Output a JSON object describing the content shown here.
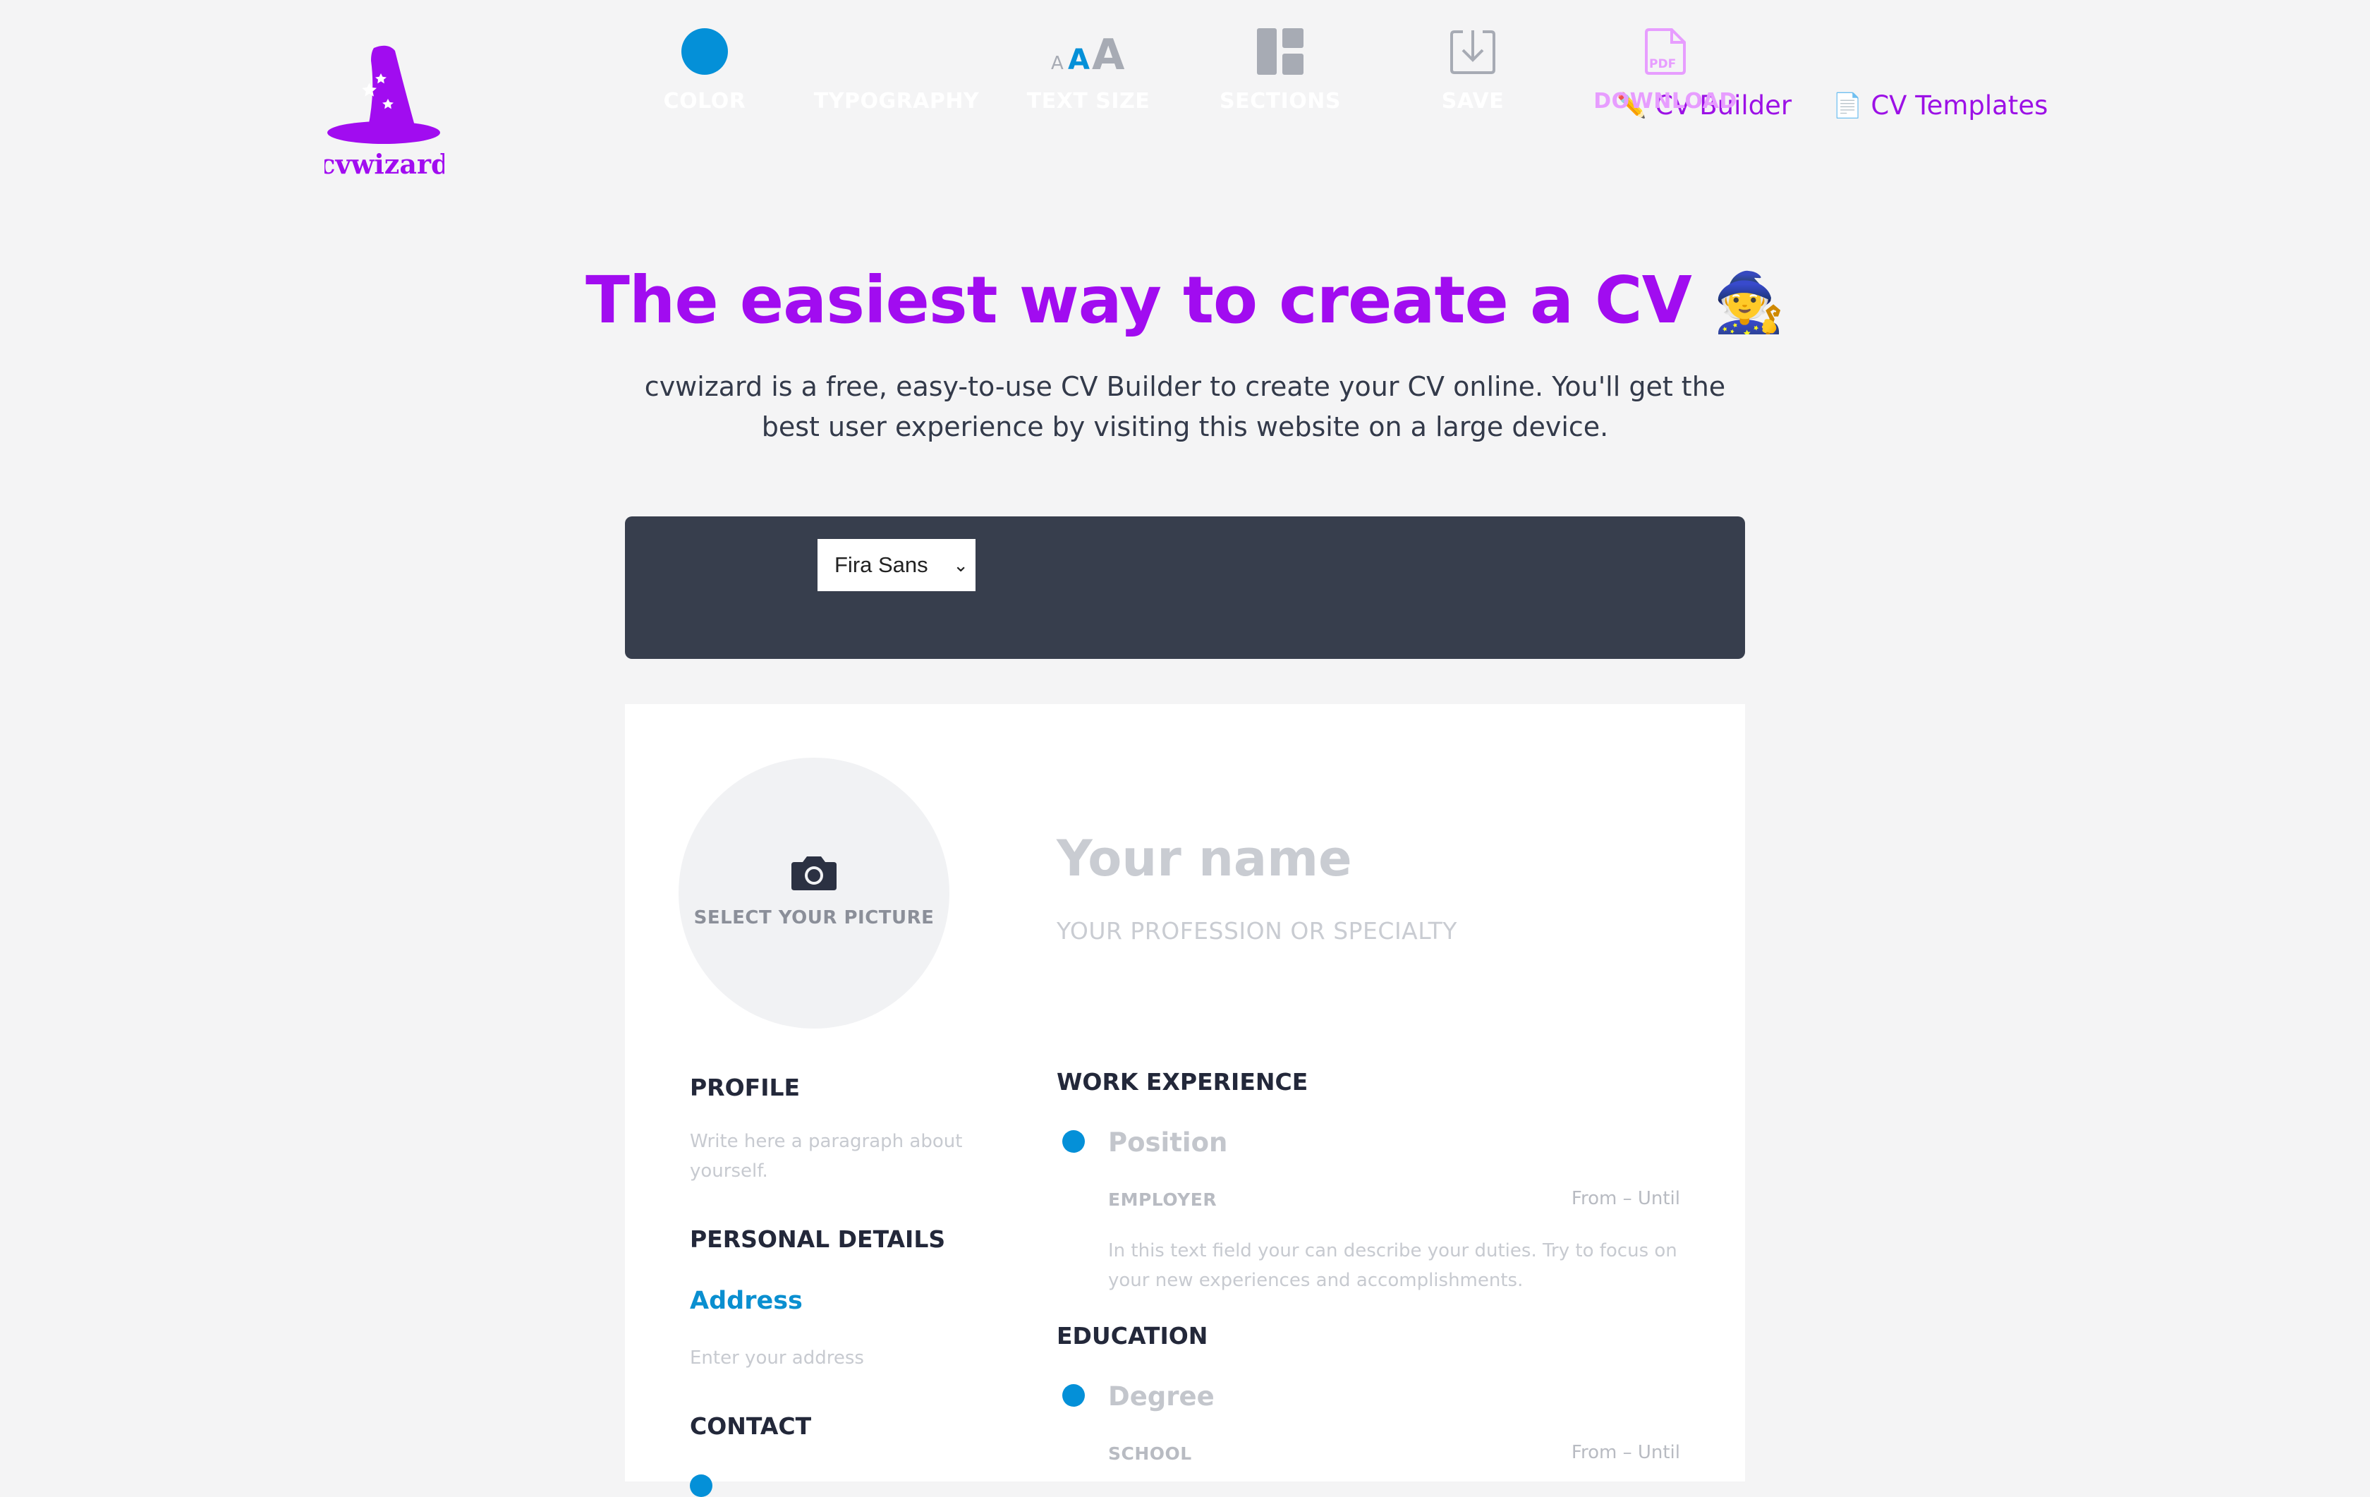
{
  "header": {
    "logo_text": "cvwizard",
    "nav": [
      {
        "icon": "✏️",
        "label": "CV Builder"
      },
      {
        "icon": "📄",
        "label": "CV Templates"
      }
    ]
  },
  "hero": {
    "title": "The easiest way to create a CV",
    "title_emoji": "🧙",
    "subtitle": "cvwizard is a free, easy-to-use CV Builder to create your CV online. You'll get the best user experience by visiting this website on a large device."
  },
  "toolbar": {
    "color_label": "COLOR",
    "accent_color": "#0490d8",
    "typography_label": "TYPOGRAPHY",
    "typography_value": "Fira Sans",
    "text_size_label": "TEXT SIZE",
    "sections_label": "SECTIONS",
    "save_label": "SAVE",
    "download_label": "DOWNLOAD",
    "pdf_badge": "PDF"
  },
  "cv": {
    "photo_label": "SELECT YOUR PICTURE",
    "name_placeholder": "Your name",
    "profession_placeholder": "YOUR PROFESSION OR SPECIALTY",
    "profile": {
      "heading": "PROFILE",
      "placeholder": "Write here a paragraph about yourself."
    },
    "personal": {
      "heading": "PERSONAL DETAILS",
      "address_label": "Address",
      "address_placeholder": "Enter your address"
    },
    "contact": {
      "heading": "CONTACT"
    },
    "work": {
      "heading": "WORK EXPERIENCE",
      "position_placeholder": "Position",
      "employer_placeholder": "EMPLOYER",
      "dates_placeholder": "From – Until",
      "description_placeholder": "In this text field your can describe your duties. Try to focus on your new experiences and accomplishments."
    },
    "education": {
      "heading": "EDUCATION",
      "degree_placeholder": "Degree",
      "school_placeholder": "SCHOOL",
      "dates_placeholder": "From – Until"
    }
  }
}
